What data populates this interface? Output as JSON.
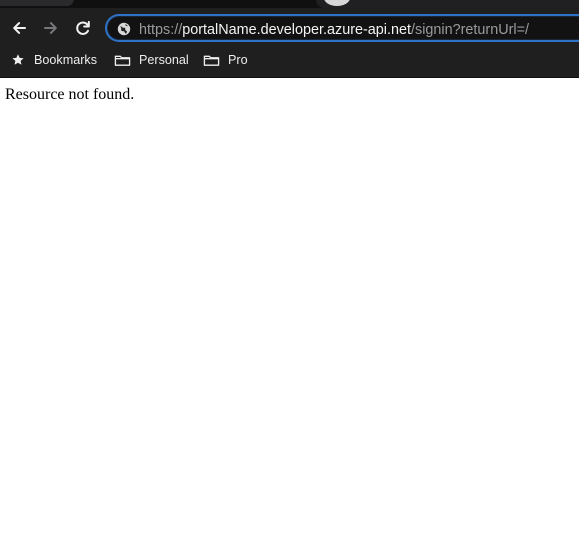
{
  "browser": {
    "address_bar": {
      "scheme": "https://",
      "host": "portalName.developer.azure-api.net",
      "path": "/signin?returnUrl=/"
    },
    "navigation": {
      "back_icon": "back-arrow-icon",
      "forward_icon": "forward-arrow-icon",
      "reload_icon": "reload-icon"
    },
    "bookmarks": [
      {
        "label": "Bookmarks",
        "icon": "star-icon"
      },
      {
        "label": "Personal",
        "icon": "folder-icon"
      },
      {
        "label": "Pro",
        "icon": "folder-icon"
      }
    ]
  },
  "page": {
    "message": "Resource not found."
  },
  "colors": {
    "chrome_background": "#1f1f20",
    "omnibox_focus": "#2f73c9",
    "url_host": "#f4f4f4",
    "url_dim": "#9a9a9d",
    "page_background": "#ffffff",
    "page_text": "#000000"
  }
}
